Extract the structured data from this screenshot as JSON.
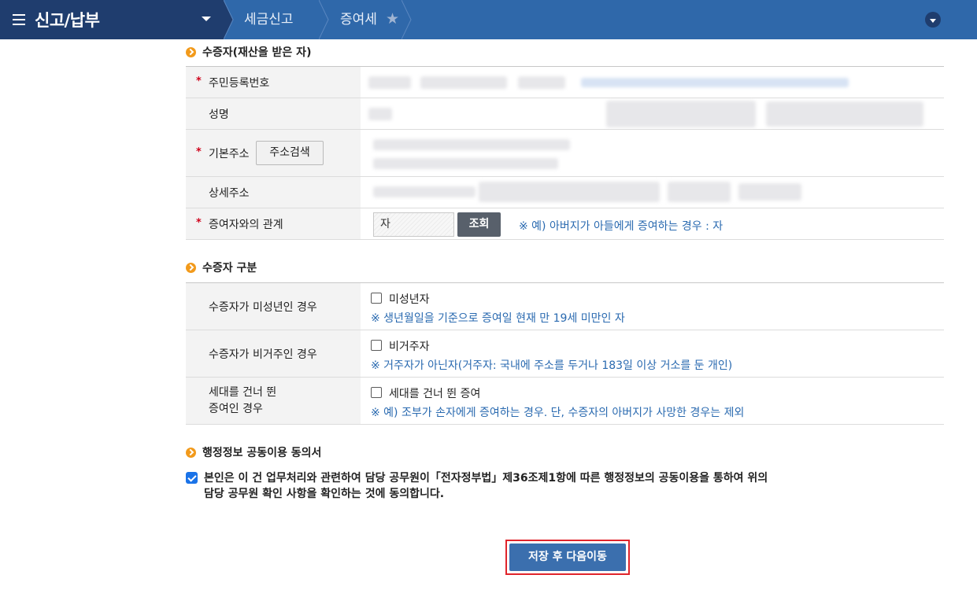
{
  "header": {
    "menu_title": "신고/납부",
    "crumbs": [
      "세금신고",
      "증여세"
    ],
    "colors": {
      "bar": "#2f68aa",
      "menu": "#1f3d6e"
    },
    "icons": [
      "menu-icon",
      "caret-down-icon",
      "star-icon",
      "chevron-down-icon"
    ]
  },
  "donee": {
    "title": "수증자(재산을 받은 자)",
    "rows": {
      "rrn": "주민등록번호",
      "name": "성명",
      "address": "기본주소",
      "address_detail": "상세주소",
      "relation": "증여자와의 관계"
    },
    "address_search_label": "주소검색",
    "relation_value": "자",
    "lookup_label": "조회",
    "relation_note": "※ 예) 아버지가 아들에게 증여하는 경우 : 자"
  },
  "category": {
    "title": "수증자 구분",
    "rows": [
      {
        "header": "수증자가 미성년인 경우",
        "checkbox_label": "미성년자",
        "note": "※ 생년월일을 기준으로 증여일 현재 만 19세 미만인 자"
      },
      {
        "header": "수증자가 비거주인 경우",
        "checkbox_label": "비거주자",
        "note": "※ 거주자가 아닌자(거주자: 국내에 주소를 두거나 183일 이상 거소를 둔 개인)"
      },
      {
        "header_line1": "세대를 건너 뛴",
        "header_line2": "증여인 경우",
        "checkbox_label": "세대를 건너 뛴 증여",
        "note": "※ 예) 조부가 손자에게 증여하는 경우. 단, 수증자의 아버지가 사망한 경우는 제외"
      }
    ]
  },
  "consent": {
    "title": "행정정보 공동이용 동의서",
    "checked": true,
    "text_line1": "본인은 이 건 업무처리와 관련하여 담당 공무원이「전자정부법」제36조제1항에 따른 행정정보의 공동이용을 통하여 위의",
    "text_line2": "담당 공무원 확인 사항을 확인하는 것에 동의합니다."
  },
  "actions": {
    "save_next_label": "저장 후 다음이동"
  }
}
